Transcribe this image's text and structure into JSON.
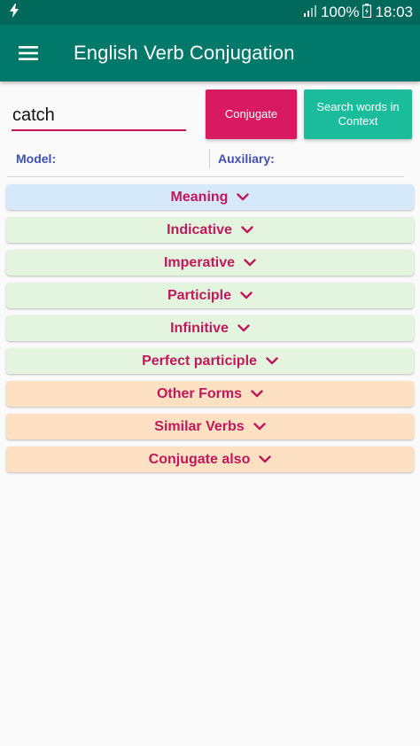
{
  "status_bar": {
    "battery": "100%",
    "time": "18:03",
    "icons": [
      "flash-icon",
      "signal-icon",
      "battery-icon"
    ]
  },
  "app_bar": {
    "title": "English Verb Conjugation",
    "menu_icon": "hamburger-menu-icon"
  },
  "search": {
    "value": "catch"
  },
  "buttons": {
    "conjugate": "Conjugate",
    "context": "Search words in Context"
  },
  "info": {
    "model_label": "Model:",
    "auxiliary_label": "Auxiliary:"
  },
  "sections": [
    {
      "label": "Meaning",
      "bg": "#d6e9fb"
    },
    {
      "label": "Indicative",
      "bg": "#e3f4df"
    },
    {
      "label": "Imperative",
      "bg": "#e3f4df"
    },
    {
      "label": "Participle",
      "bg": "#e3f4df"
    },
    {
      "label": "Infinitive",
      "bg": "#e3f4df"
    },
    {
      "label": "Perfect participle",
      "bg": "#e3f4df"
    },
    {
      "label": "Other Forms",
      "bg": "#fde1c2"
    },
    {
      "label": "Similar Verbs",
      "bg": "#fde1c2"
    },
    {
      "label": "Conjugate also",
      "bg": "#fde1c2"
    }
  ],
  "colors": {
    "primary": "#00796b",
    "accent": "#d81b60",
    "secondary_button": "#1abc9c",
    "section_text": "#c2185b",
    "label_blue": "#3f51b5"
  }
}
